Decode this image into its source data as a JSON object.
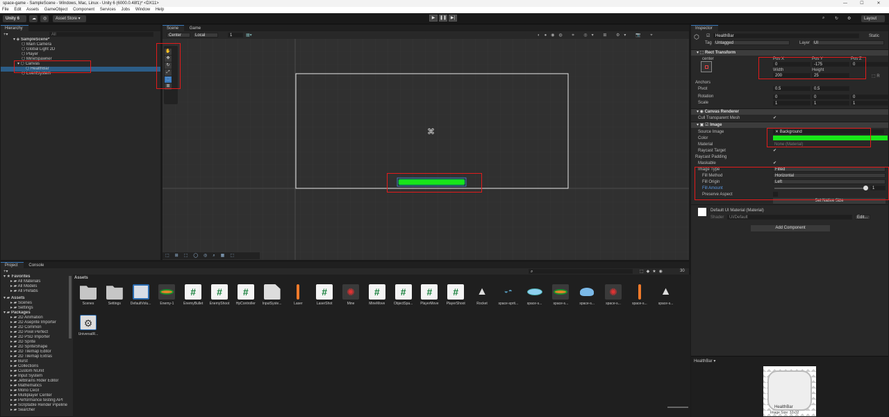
{
  "window": {
    "title": "space-game - SampleScene - Windows, Mac, Linux - Unity 6 (6000.0.48f1)* <DX11>"
  },
  "menu": [
    "File",
    "Edit",
    "Assets",
    "GameObject",
    "Component",
    "Services",
    "Jobs",
    "Window",
    "Help"
  ],
  "toolbar": {
    "account": "Unity 6",
    "asset_store": "Asset Store ▾",
    "layout": "Layout"
  },
  "hierarchy": {
    "tab": "Hierarchy",
    "search_placeholder": "All",
    "items": [
      {
        "label": "SampleScene*",
        "indent": 0
      },
      {
        "label": "Main Camera",
        "indent": 2
      },
      {
        "label": "Global Light 2D",
        "indent": 2
      },
      {
        "label": "Player",
        "indent": 2
      },
      {
        "label": "MineSpawner",
        "indent": 2
      },
      {
        "label": "Canvas",
        "indent": 1
      },
      {
        "label": "HealthBar",
        "indent": 3
      },
      {
        "label": "EventSystem",
        "indent": 2
      }
    ]
  },
  "scene": {
    "tabs": [
      "Scene",
      "Game"
    ],
    "pivot": "Center",
    "space": "Local",
    "grid_count": "1"
  },
  "inspector": {
    "tab": "Inspector",
    "object_name": "HealthBar",
    "static_label": "Static",
    "tag_label": "Tag",
    "tag": "Untagged",
    "layer_label": "Layer",
    "layer": "UI",
    "rect_transform": {
      "title": "Rect Transform",
      "anchor_label": "center",
      "pos_labels": [
        "Pos X",
        "Pos Y",
        "Pos Z"
      ],
      "pos": [
        "0",
        "-175",
        "0"
      ],
      "size_labels": [
        "Width",
        "Height"
      ],
      "size": [
        "200",
        "25"
      ],
      "anchors": "Anchors",
      "pivot_label": "Pivot",
      "pivot": [
        "0.5",
        "0.5"
      ],
      "rotation_label": "Rotation",
      "rotation": [
        "0",
        "0",
        "0"
      ],
      "scale_label": "Scale",
      "scale": [
        "1",
        "1",
        "1"
      ]
    },
    "canvas_renderer": {
      "title": "Canvas Renderer",
      "cull_label": "Cull Transparent Mesh"
    },
    "image": {
      "title": "Image",
      "source_label": "Source Image",
      "source": "Background",
      "color_label": "Color",
      "color": "#19e619",
      "material_label": "Material",
      "material": "None (Material)",
      "raycast_target": "Raycast Target",
      "raycast_padding": "Raycast Padding",
      "maskable": "Maskable",
      "image_type_label": "Image Type",
      "image_type": "Filled",
      "fill_method_label": "Fill Method",
      "fill_method": "Horizontal",
      "fill_origin_label": "Fill Origin",
      "fill_origin": "Left",
      "fill_amount_label": "Fill Amount",
      "fill_amount": "1",
      "preserve_aspect": "Preserve Aspect",
      "set_native": "Set Native Size"
    },
    "material_block": {
      "name": "Default UI Material (Material)",
      "shader_label": "Shader",
      "shader": "UI/Default",
      "edit": "Edit..."
    },
    "add_component": "Add Component",
    "preview_label": "HealthBar ▾",
    "preview_caption": "HealthBar",
    "preview_sub": "Image Size: 32x32"
  },
  "project": {
    "tabs": [
      "Project",
      "Console"
    ],
    "favorites": [
      "Favorites",
      "All Materials",
      "All Models",
      "All Prefabs"
    ],
    "assets_tree": [
      "Assets",
      "Scenes",
      "Settings"
    ],
    "packages": [
      "Packages",
      "2D Animation",
      "2D Aseprite Importer",
      "2D Common",
      "2D Pixel Perfect",
      "2D PSD Importer",
      "2D Sprite",
      "2D SpriteShape",
      "2D Tilemap Editor",
      "2D Tilemap Extras",
      "Burst",
      "Collections",
      "Custom NUnit",
      "Input System",
      "JetBrains Rider Editor",
      "Mathematics",
      "Mono Cecil",
      "Multiplayer Center",
      "Performance testing API",
      "Scriptable Render Pipeline",
      "Searcher"
    ],
    "breadcrumb": "Assets",
    "asset_count": "30",
    "assets": [
      {
        "name": "Scenes",
        "kind": "folder"
      },
      {
        "name": "Settings",
        "kind": "folder"
      },
      {
        "name": "DefaultVolu...",
        "kind": "cube"
      },
      {
        "name": "Enemy-1",
        "kind": "ship"
      },
      {
        "name": "EnemyBullet",
        "kind": "script"
      },
      {
        "name": "EnemyShoot",
        "kind": "script"
      },
      {
        "name": "HpController",
        "kind": "script"
      },
      {
        "name": "InputSyste...",
        "kind": "input"
      },
      {
        "name": "Laser",
        "kind": "laser"
      },
      {
        "name": "LaserShot",
        "kind": "script"
      },
      {
        "name": "Mine",
        "kind": "mine"
      },
      {
        "name": "MineMove",
        "kind": "script"
      },
      {
        "name": "ObjectSpa...",
        "kind": "script"
      },
      {
        "name": "PlayerMove",
        "kind": "script"
      },
      {
        "name": "PlayerShoot",
        "kind": "script"
      },
      {
        "name": "Rocket",
        "kind": "rocket"
      },
      {
        "name": "space-sprit...",
        "kind": "sheet"
      },
      {
        "name": "space-s...",
        "kind": "ufo"
      },
      {
        "name": "space-s...",
        "kind": "ship"
      },
      {
        "name": "space-s...",
        "kind": "ufo2"
      },
      {
        "name": "space-s...",
        "kind": "mine"
      },
      {
        "name": "space-s...",
        "kind": "laser"
      },
      {
        "name": "space-s...",
        "kind": "rocket"
      },
      {
        "name": "UniversalR...",
        "kind": "gear"
      }
    ]
  },
  "colors": {
    "accent": "#3a79bb",
    "selection": "#2c5d87",
    "highlight": "#e31b1b",
    "fill": "#19e619"
  }
}
